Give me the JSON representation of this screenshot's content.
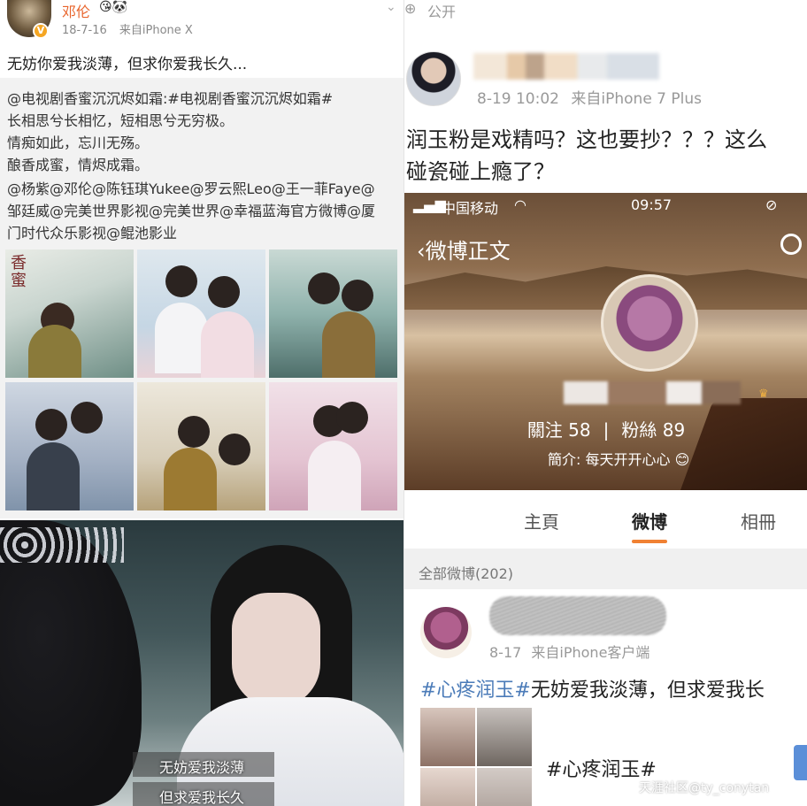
{
  "left": {
    "author": {
      "name": "邓伦",
      "icons": "😘🐼"
    },
    "meta": {
      "date": "18-7-16",
      "source": "来自iPhone X"
    },
    "post_text": "无妨你爱我淡薄，但求你爱我长久...",
    "repost": {
      "line1": "@电视剧香蜜沉沉烬如霜:#电视剧香蜜沉沉烬如霜#",
      "line2": "长相思兮长相忆，短相思兮无穷极。",
      "line3": "情痴如此，忘川无殇。",
      "line4": "酿香成蜜，情烬成霜。",
      "line5": "@杨紫@邓伦@陈钰琪Yukee@罗云熙Leo@王一菲Faye@",
      "line6": "邹廷威@完美世界影视@完美世界@幸福蓝海官方微博@厦",
      "line7": "门时代众乐影视@鲲池影业"
    },
    "subtitles": [
      "无妨爱我淡薄",
      "但求爱我长久"
    ]
  },
  "right": {
    "visibility": "公开",
    "post_meta": {
      "time": "8-19 10:02",
      "source": "来自iPhone 7 Plus"
    },
    "post_text_line1": "润玉粉是戏精吗？这也要抄？？？这么",
    "post_text_line2": "碰瓷碰上瘾了？",
    "phone": {
      "carrier": "中国移动",
      "time": "09:57",
      "back_label": "微博正文",
      "follow": "關注 58",
      "fans": "粉絲 89",
      "bio": "簡介: 每天开开心心 😊"
    },
    "tabs": [
      "主頁",
      "微博",
      "相冊"
    ],
    "all_posts": "全部微博(202)",
    "inner_post": {
      "time": "8-17",
      "source": "来自iPhone客户端",
      "hashtag": "#心疼润玉#",
      "text": "无妨爱我淡薄，但求爱我长",
      "card_text": "#心疼润玉#"
    },
    "watermark": "天涯社区@ty_conytan"
  }
}
